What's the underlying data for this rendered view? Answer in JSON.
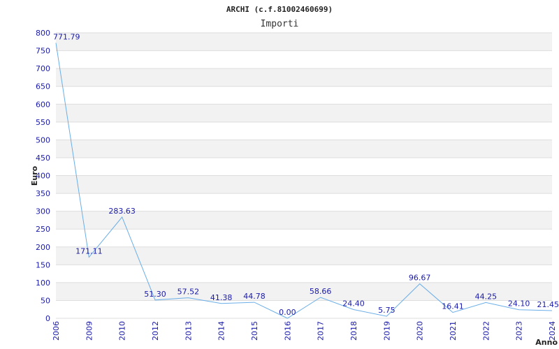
{
  "chart_data": {
    "type": "line",
    "title": "ARCHI (c.f.81002460699)",
    "subtitle": "Importi",
    "xlabel": "Anno",
    "ylabel": "Euro",
    "ylim": [
      0,
      800
    ],
    "y_ticks": [
      "0",
      "50",
      "100",
      "150",
      "200",
      "250",
      "300",
      "350",
      "400",
      "450",
      "500",
      "550",
      "600",
      "650",
      "700",
      "750",
      "800"
    ],
    "categories": [
      "2006",
      "2009",
      "2010",
      "2012",
      "2013",
      "2014",
      "2015",
      "2016",
      "2017",
      "2018",
      "2019",
      "2020",
      "2021",
      "2022",
      "2023",
      "2024"
    ],
    "values": [
      771.79,
      171.11,
      283.63,
      51.3,
      57.52,
      41.38,
      44.78,
      0.0,
      58.66,
      24.4,
      5.75,
      96.67,
      16.41,
      44.25,
      24.1,
      21.45
    ],
    "value_labels": [
      "771.79",
      "171.11",
      "283.63",
      "51.30",
      "57.52",
      "41.38",
      "44.78",
      "0.00",
      "58.66",
      "24.40",
      "5.75",
      "96.67",
      "16.41",
      "44.25",
      "24.10",
      "21.45"
    ],
    "grid": true,
    "colors": {
      "line": "#6aaee8",
      "band": "#f2f2f2",
      "grid": "#dddddd",
      "tick_text": "#1a1aaa"
    }
  }
}
